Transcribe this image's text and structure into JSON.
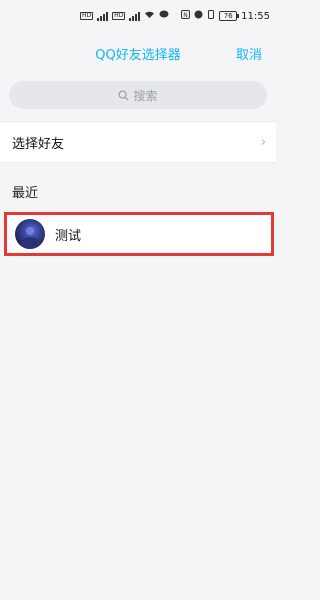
{
  "statusbar": {
    "time": "11:55",
    "battery": "76",
    "network_badge": "HD"
  },
  "navbar": {
    "title": "QQ好友选择器",
    "cancel_label": "取消"
  },
  "search": {
    "placeholder": "搜索",
    "icon": "search-icon"
  },
  "friends_row": {
    "label": "选择好友",
    "icon": "chevron-right-icon"
  },
  "recent": {
    "title": "最近",
    "items": [
      {
        "name": "测试"
      }
    ]
  },
  "colors": {
    "accent": "#12b7f5",
    "highlight": "#e53935",
    "background": "#f5f5f7"
  }
}
